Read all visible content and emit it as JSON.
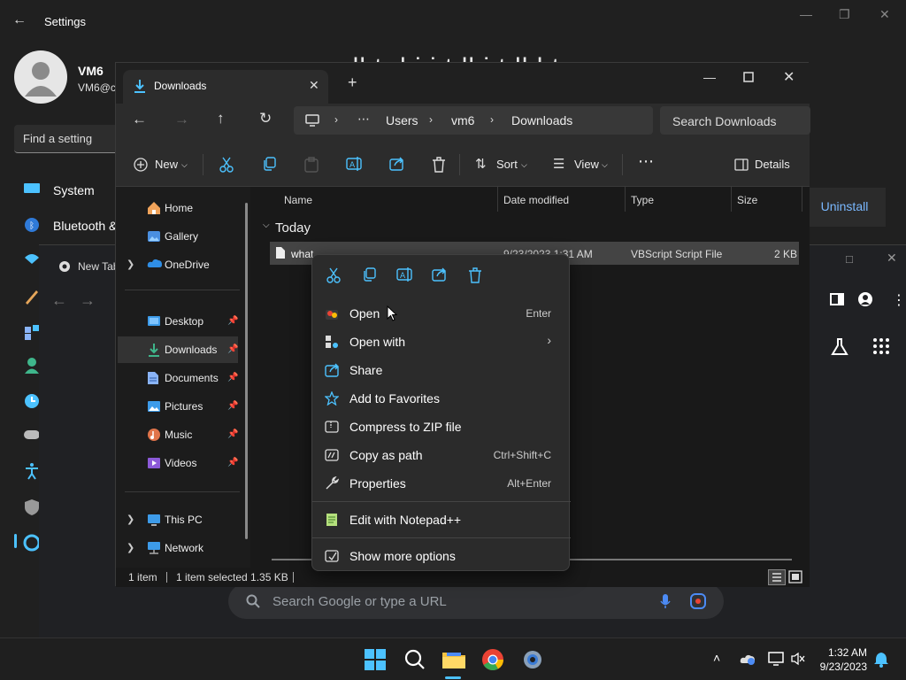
{
  "settings": {
    "title": "Settings",
    "user_name": "VM6",
    "user_email": "VM6@c",
    "find_placeholder": "Find a setting",
    "nav": [
      "System",
      "Bluetooth &"
    ],
    "uninstall_label": "Uninstall",
    "ghost_text": "..dl   t   d  i i t      ll i   t  ll     l t"
  },
  "chrome": {
    "tab_label": "New Tab",
    "omnibox_placeholder": "Search Google or type a URL"
  },
  "explorer": {
    "tab_title": "Downloads",
    "breadcrumb": [
      "Users",
      "vm6",
      "Downloads"
    ],
    "search_placeholder": "Search Downloads",
    "toolbar": {
      "new_label": "New",
      "sort_label": "Sort",
      "view_label": "View",
      "details_label": "Details"
    },
    "sidebar": {
      "home": "Home",
      "gallery": "Gallery",
      "onedrive": "OneDrive",
      "desktop": "Desktop",
      "downloads": "Downloads",
      "documents": "Documents",
      "pictures": "Pictures",
      "music": "Music",
      "videos": "Videos",
      "thispc": "This PC",
      "network": "Network"
    },
    "columns": {
      "name": "Name",
      "date": "Date modified",
      "type": "Type",
      "size": "Size"
    },
    "group_label": "Today",
    "file": {
      "name": "what",
      "date": "9/23/2023 1:31 AM",
      "type": "VBScript Script File",
      "size": "2 KB"
    },
    "status": {
      "count": "1 item",
      "selected": "1 item selected  1.35 KB"
    }
  },
  "context_menu": {
    "open": {
      "label": "Open",
      "shortcut": "Enter"
    },
    "open_with": {
      "label": "Open with"
    },
    "share": {
      "label": "Share"
    },
    "favorites": {
      "label": "Add to Favorites"
    },
    "zip": {
      "label": "Compress to ZIP file"
    },
    "copy_path": {
      "label": "Copy as path",
      "shortcut": "Ctrl+Shift+C"
    },
    "properties": {
      "label": "Properties",
      "shortcut": "Alt+Enter"
    },
    "notepad": {
      "label": "Edit with Notepad++"
    },
    "more": {
      "label": "Show more options"
    }
  },
  "taskbar": {
    "time": "1:32 AM",
    "date": "9/23/2023"
  },
  "colors": {
    "accent": "#4cc2ff",
    "folder": "#f5c342",
    "link": "#7ab8ff"
  }
}
